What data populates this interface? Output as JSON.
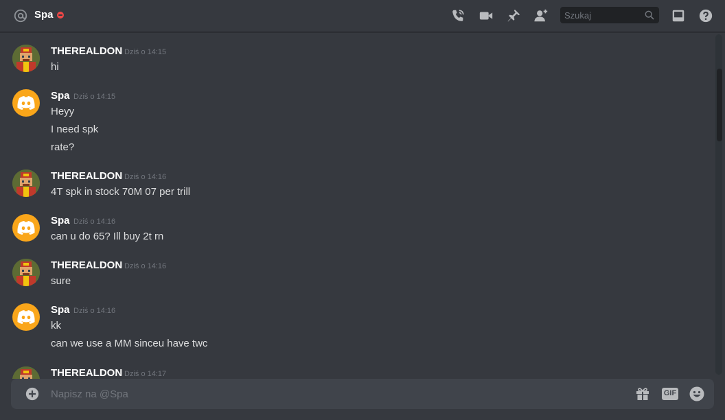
{
  "header": {
    "dm_name": "Spa",
    "status": "do-not-disturb",
    "status_color": "#f04747",
    "icons": [
      "at-icon",
      "phone-call-icon",
      "video-call-icon",
      "pin-icon",
      "add-friend-icon",
      "inbox-icon",
      "help-icon"
    ],
    "search": {
      "placeholder": "Szukaj",
      "value": ""
    }
  },
  "messages": [
    {
      "author": "THEREALDON",
      "avatar": "pixel-art-avatar",
      "timestamp": "Dziś o 14:15",
      "lines": [
        "hi"
      ]
    },
    {
      "author": "Spa",
      "avatar": "discord-logo-avatar",
      "timestamp": "Dziś o 14:15",
      "lines": [
        "Heyy",
        "I need spk",
        "rate?"
      ]
    },
    {
      "author": "THEREALDON",
      "avatar": "pixel-art-avatar",
      "timestamp": "Dziś o 14:16",
      "lines": [
        "4T spk in stock 70M 07 per trill"
      ]
    },
    {
      "author": "Spa",
      "avatar": "discord-logo-avatar",
      "timestamp": "Dziś o 14:16",
      "lines": [
        "can u do 65? Ill buy 2t rn"
      ]
    },
    {
      "author": "THEREALDON",
      "avatar": "pixel-art-avatar",
      "timestamp": "Dziś o 14:16",
      "lines": [
        "sure"
      ]
    },
    {
      "author": "Spa",
      "avatar": "discord-logo-avatar",
      "timestamp": "Dziś o 14:16",
      "lines": [
        "kk",
        "can we use a MM sinceu have twc"
      ]
    },
    {
      "author": "THEREALDON",
      "avatar": "pixel-art-avatar",
      "timestamp": "Dziś o 14:17",
      "lines": []
    }
  ],
  "composer": {
    "placeholder": "Napisz na @Spa",
    "value": "",
    "icons": [
      "add-attachment-icon",
      "gift-icon",
      "gif-icon",
      "emoji-icon"
    ],
    "gif_label": "GIF"
  },
  "colors": {
    "background": "#36393f",
    "composer": "#40444b",
    "text": "#dcddde",
    "muted": "#72767d",
    "spa_avatar": "#faa61a"
  }
}
